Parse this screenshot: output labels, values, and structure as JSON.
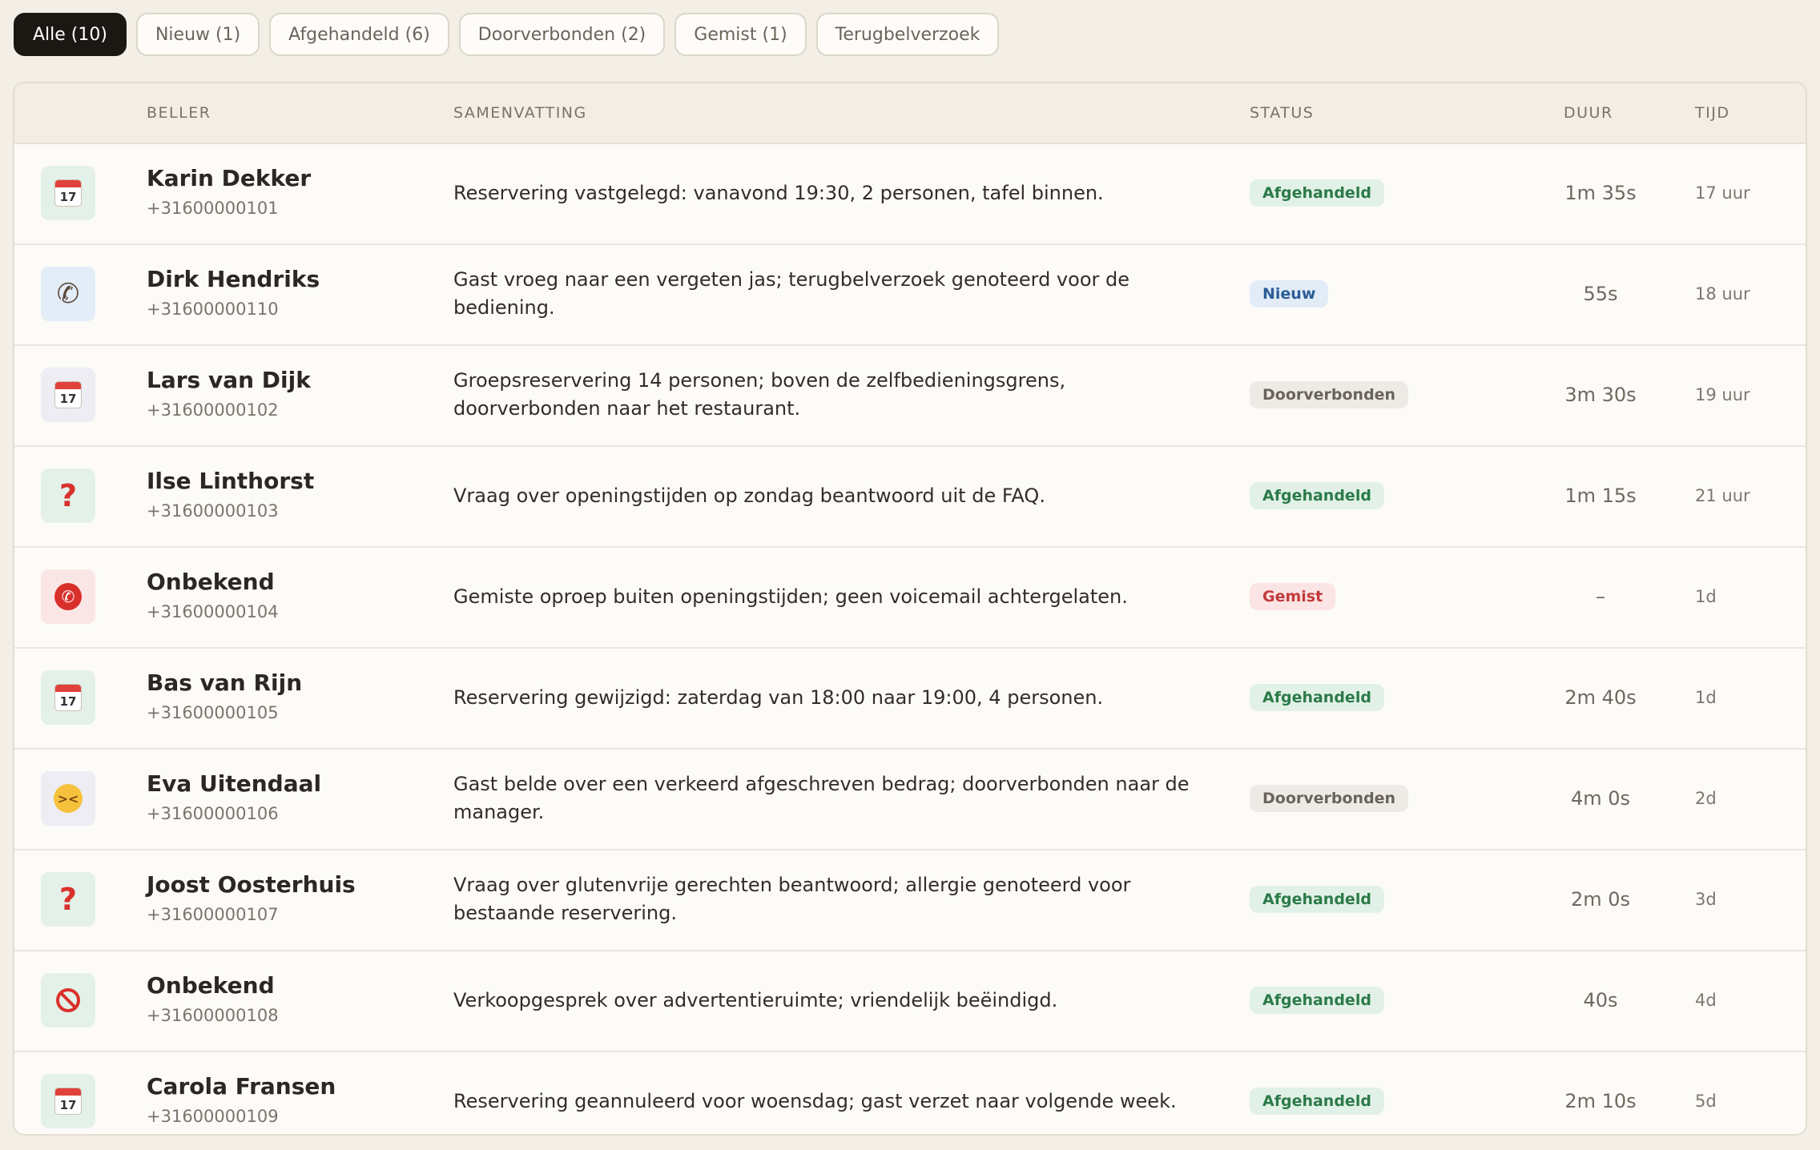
{
  "filters": [
    {
      "label": "Alle (10)",
      "active": true
    },
    {
      "label": "Nieuw (1)",
      "active": false
    },
    {
      "label": "Afgehandeld (6)",
      "active": false
    },
    {
      "label": "Doorverbonden (2)",
      "active": false
    },
    {
      "label": "Gemist (1)",
      "active": false
    },
    {
      "label": "Terugbelverzoek",
      "active": false
    }
  ],
  "table": {
    "headers": {
      "caller": "BELLER",
      "summary": "SAMENVATTING",
      "status": "STATUS",
      "duration": "DUUR",
      "time": "TIJD"
    },
    "rows": [
      {
        "icon": "calendar-icon",
        "name": "Karin Dekker",
        "phone": "+31600000101",
        "summary": "Reservering vastgelegd: vanavond 19:30, 2 personen, tafel binnen.",
        "status": "Afgehandeld",
        "duration": "1m 35s",
        "time": "17 uur"
      },
      {
        "icon": "phone-icon",
        "name": "Dirk Hendriks",
        "phone": "+31600000110",
        "summary": "Gast vroeg naar een vergeten jas; terugbelverzoek genoteerd voor de bediening.",
        "status": "Nieuw",
        "duration": "55s",
        "time": "18 uur"
      },
      {
        "icon": "calendar-icon",
        "name": "Lars van Dijk",
        "phone": "+31600000102",
        "summary": "Groepsreservering 14 personen; boven de zelfbedieningsgrens, doorverbonden naar het restaurant.",
        "status": "Doorverbonden",
        "duration": "3m 30s",
        "time": "19 uur"
      },
      {
        "icon": "question-icon",
        "name": "Ilse Linthorst",
        "phone": "+31600000103",
        "summary": "Vraag over openingstijden op zondag beantwoord uit de FAQ.",
        "status": "Afgehandeld",
        "duration": "1m 15s",
        "time": "21 uur"
      },
      {
        "icon": "no-phone-icon",
        "name": "Onbekend",
        "phone": "+31600000104",
        "summary": "Gemiste oproep buiten openingstijden; geen voicemail achtergelaten.",
        "status": "Gemist",
        "duration": "–",
        "time": "1d"
      },
      {
        "icon": "calendar-icon",
        "name": "Bas van Rijn",
        "phone": "+31600000105",
        "summary": "Reservering gewijzigd: zaterdag van 18:00 naar 19:00, 4 personen.",
        "status": "Afgehandeld",
        "duration": "2m 40s",
        "time": "1d"
      },
      {
        "icon": "angry-face-icon",
        "name": "Eva Uitendaal",
        "phone": "+31600000106",
        "summary": "Gast belde over een verkeerd afgeschreven bedrag; doorverbonden naar de manager.",
        "status": "Doorverbonden",
        "duration": "4m 0s",
        "time": "2d"
      },
      {
        "icon": "question-icon",
        "name": "Joost Oosterhuis",
        "phone": "+31600000107",
        "summary": "Vraag over glutenvrije gerechten beantwoord; allergie genoteerd voor bestaande reservering.",
        "status": "Afgehandeld",
        "duration": "2m 0s",
        "time": "3d"
      },
      {
        "icon": "prohibited-icon",
        "name": "Onbekend",
        "phone": "+31600000108",
        "summary": "Verkoopgesprek over advertentieruimte; vriendelijk beëindigd.",
        "status": "Afgehandeld",
        "duration": "40s",
        "time": "4d"
      },
      {
        "icon": "calendar-icon",
        "name": "Carola Fransen",
        "phone": "+31600000109",
        "summary": "Reservering geannuleerd voor woensdag; gast verzet naar volgende week.",
        "status": "Afgehandeld",
        "duration": "2m 10s",
        "time": "5d"
      }
    ]
  },
  "colors": {
    "background": "#f3efe6",
    "active_tab": "#1b1814",
    "status_done": "#2b7a48",
    "status_new": "#2a5d96",
    "status_forwarded": "#6a635b",
    "status_missed": "#c23b3b"
  }
}
